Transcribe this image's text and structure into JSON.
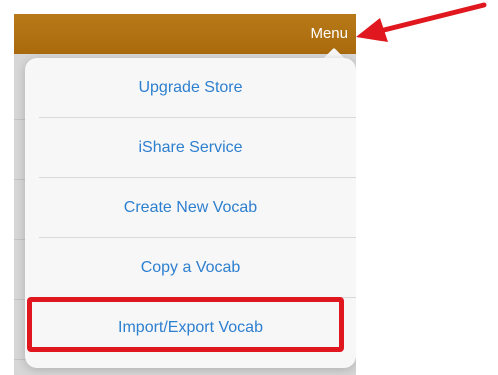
{
  "header": {
    "menu_label": "Menu",
    "bar_color": "#b07214"
  },
  "menu": {
    "items": [
      {
        "label": "Upgrade Store"
      },
      {
        "label": "iShare Service"
      },
      {
        "label": "Create New Vocab"
      },
      {
        "label": "Copy a Vocab"
      },
      {
        "label": "Import/Export Vocab"
      }
    ],
    "item_color": "#2d7fd0"
  },
  "annotations": {
    "highlighted_item": "Import/Export Vocab",
    "highlight_color": "#e0171f",
    "arrow_target": "Menu"
  }
}
